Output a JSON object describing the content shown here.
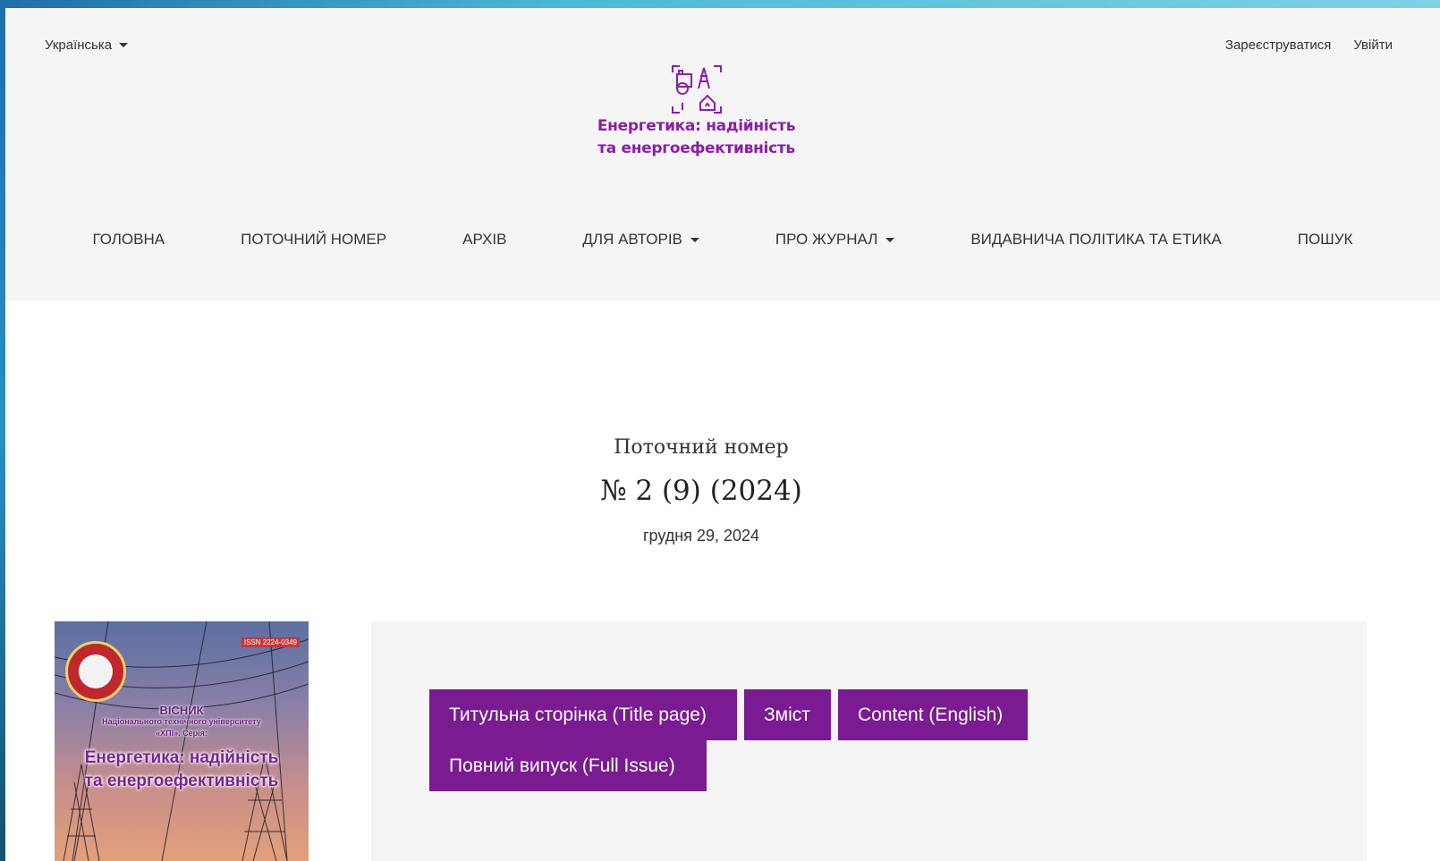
{
  "header": {
    "language": "Українська",
    "register": "Зареєструватися",
    "login": "Увійти",
    "logo_line1": "Енергетика: надійність",
    "logo_line2": "та енергоефективність"
  },
  "nav": {
    "items": [
      {
        "label": "ГОЛОВНА"
      },
      {
        "label": "ПОТОЧНИЙ НОМЕР"
      },
      {
        "label": "АРХІВ"
      },
      {
        "label": "ДЛЯ АВТОРІВ"
      },
      {
        "label": "ПРО ЖУРНАЛ"
      },
      {
        "label": "ВИДАВНИЧА ПОЛІТИКА ТА ЕТИКА"
      },
      {
        "label": "ПОШУК"
      }
    ]
  },
  "issue": {
    "section_label": "Поточний номер",
    "title": "№ 2 (9) (2024)",
    "date": "грудня 29, 2024"
  },
  "cover": {
    "issn": "ISSN 2224-0349",
    "visnyk": "ВІСНИК",
    "sub1": "Національного технічного університету",
    "sub2": "«ХПІ». Серія:",
    "title1": "Енергетика: надійність",
    "title2": "та енергоефективність"
  },
  "galleys": [
    {
      "label": "Титульна сторінка (Title page)"
    },
    {
      "label": "Зміст"
    },
    {
      "label": "Content (English)"
    },
    {
      "label": "Повний випуск (Full Issue)"
    }
  ],
  "colors": {
    "accent": "#7a1b91",
    "logo": "#8b1fa6",
    "header_bg": "#f5f5f5"
  }
}
